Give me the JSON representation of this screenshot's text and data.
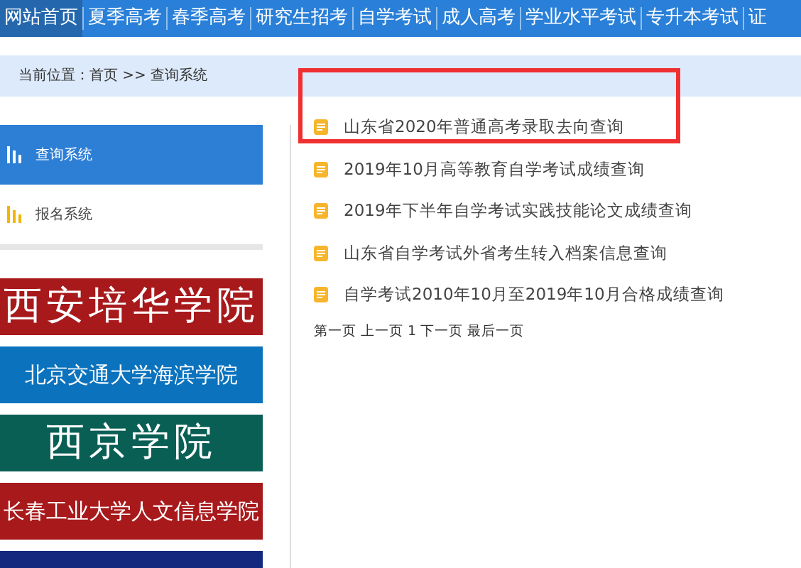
{
  "nav": [
    {
      "label": "网站首页",
      "selected": true
    },
    {
      "label": "夏季高考",
      "selected": false
    },
    {
      "label": "春季高考",
      "selected": false
    },
    {
      "label": "研究生招考",
      "selected": false
    },
    {
      "label": "自学考试",
      "selected": false
    },
    {
      "label": "成人高考",
      "selected": false
    },
    {
      "label": "学业水平考试",
      "selected": false
    },
    {
      "label": "专升本考试",
      "selected": false
    },
    {
      "label": "证",
      "selected": false
    }
  ],
  "breadcrumb": "当前位置：首页 >> 查询系统",
  "sidebar": {
    "items": [
      {
        "label": "查询系统",
        "selected": true
      },
      {
        "label": "报名系统",
        "selected": false
      }
    ]
  },
  "banners": [
    {
      "text": "西安培华学院",
      "kind": "large",
      "color": "#a8191c"
    },
    {
      "text": "北京交通大学海滨学院",
      "kind": "small",
      "color": "#0b72bd"
    },
    {
      "text": "西京学院",
      "kind": "large",
      "color": "#0a5f55"
    },
    {
      "text": "长春工业大学人文信息学院",
      "kind": "small",
      "color": "#a8191c"
    },
    {
      "kind": "blank",
      "color": "#14297e"
    }
  ],
  "links": [
    {
      "label": "山东省2020年普通高考录取去向查询",
      "highlighted": true
    },
    {
      "label": "2019年10月高等教育自学考试成绩查询",
      "highlighted": false
    },
    {
      "label": "2019年下半年自学考试实践技能论文成绩查询",
      "highlighted": false
    },
    {
      "label": "山东省自学考试外省考生转入档案信息查询",
      "highlighted": false
    },
    {
      "label": "自学考试2010年10月至2019年10月合格成绩查询",
      "highlighted": false
    }
  ],
  "pagination": "第一页 上一页 1 下一页 最后一页"
}
